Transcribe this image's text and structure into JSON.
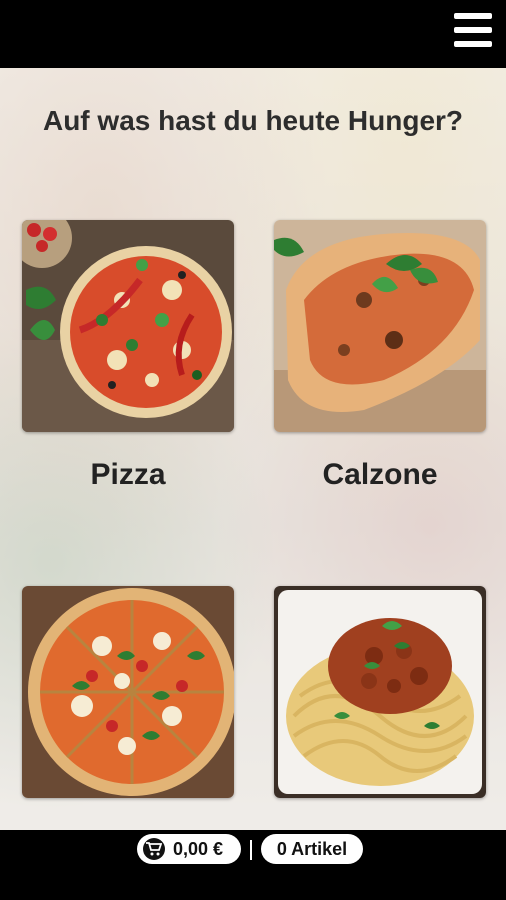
{
  "header": {
    "menu_icon": "hamburger-menu-icon"
  },
  "main": {
    "title": "Auf was hast du heute Hunger?",
    "categories": [
      {
        "label": "Pizza",
        "image": "pizza-photo"
      },
      {
        "label": "Calzone",
        "image": "calzone-photo"
      },
      {
        "label": "",
        "image": "sliced-pizza-photo"
      },
      {
        "label": "",
        "image": "spaghetti-bolognese-photo"
      }
    ]
  },
  "footer": {
    "cart_icon": "shopping-cart-icon",
    "cart_total": "0,00 €",
    "item_count": "0 Artikel"
  },
  "colors": {
    "bar_background": "#000000",
    "title_text": "#2d2d2d",
    "pill_background": "#ffffff"
  }
}
